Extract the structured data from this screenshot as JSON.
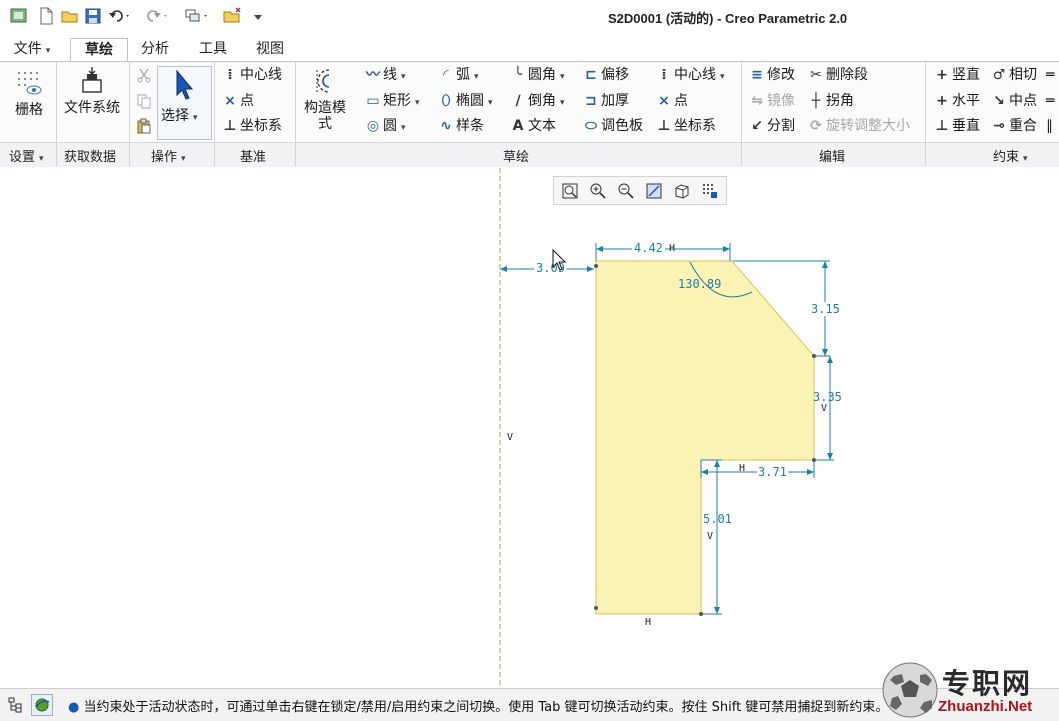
{
  "window": {
    "title": "S2D0001 (活动的) - Creo Parametric 2.0"
  },
  "tabs": [
    {
      "label": "文件",
      "has_dropdown": true
    },
    {
      "label": "草绘",
      "active": true
    },
    {
      "label": "分析"
    },
    {
      "label": "工具"
    },
    {
      "label": "视图"
    }
  ],
  "ribbon": {
    "settings": {
      "grid_label": "栅格"
    },
    "get_data": {
      "file_system_label": "文件系统"
    },
    "operations": {
      "select_label": "选择"
    },
    "datum": {
      "centerline": "中心线",
      "point": "点",
      "csys": "坐标系"
    },
    "construction_mode": "构造模式",
    "sketch": {
      "line": "线",
      "rectangle": "矩形",
      "circle": "圆",
      "arc": "弧",
      "ellipse": "椭圆",
      "spline": "样条",
      "fillet": "圆角",
      "chamfer": "倒角",
      "text": "文本",
      "offset": "偏移",
      "thicken": "加厚",
      "palette": "调色板",
      "centerline": "中心线",
      "point": "点",
      "csys": "坐标系"
    },
    "edit": {
      "modify": "修改",
      "mirror": "镜像",
      "divide": "分割",
      "delete_segment": "删除段",
      "corner": "拐角",
      "rotate_resize": "旋转调整大小"
    },
    "constrain": {
      "vertical": "竖直",
      "horizontal": "水平",
      "perpendicular": "垂直",
      "tangent": "相切",
      "midpoint": "中点",
      "coincident": "重合"
    },
    "groups": {
      "settings": "设置",
      "get_data": "获取数据",
      "operations": "操作",
      "datum": "基准",
      "sketch": "草绘",
      "edit": "编辑",
      "constrain": "约束"
    }
  },
  "sketch": {
    "dimensions": {
      "top_width": "4.42",
      "left_offset": "3.09",
      "angle": "130.89",
      "chamfer_height": "3.15",
      "right_height": "3.35",
      "step_width": "3.71",
      "lower_height": "5.01"
    },
    "constraint_markers": {
      "horizontal": "H",
      "vertical": "V"
    },
    "fill_color": "#fbf3b4",
    "dimension_color": "#1d7fae"
  },
  "status": {
    "message": "当约束处于活动状态时，可通过单击右键在锁定/禁用/启用约束之间切换。使用 Tab 键可切换活动约束。按住 Shift 键可禁用捕捉到新约束。"
  },
  "watermark": {
    "brand_cn": "专职网",
    "brand_url": "Zhuanzhi.Net"
  }
}
